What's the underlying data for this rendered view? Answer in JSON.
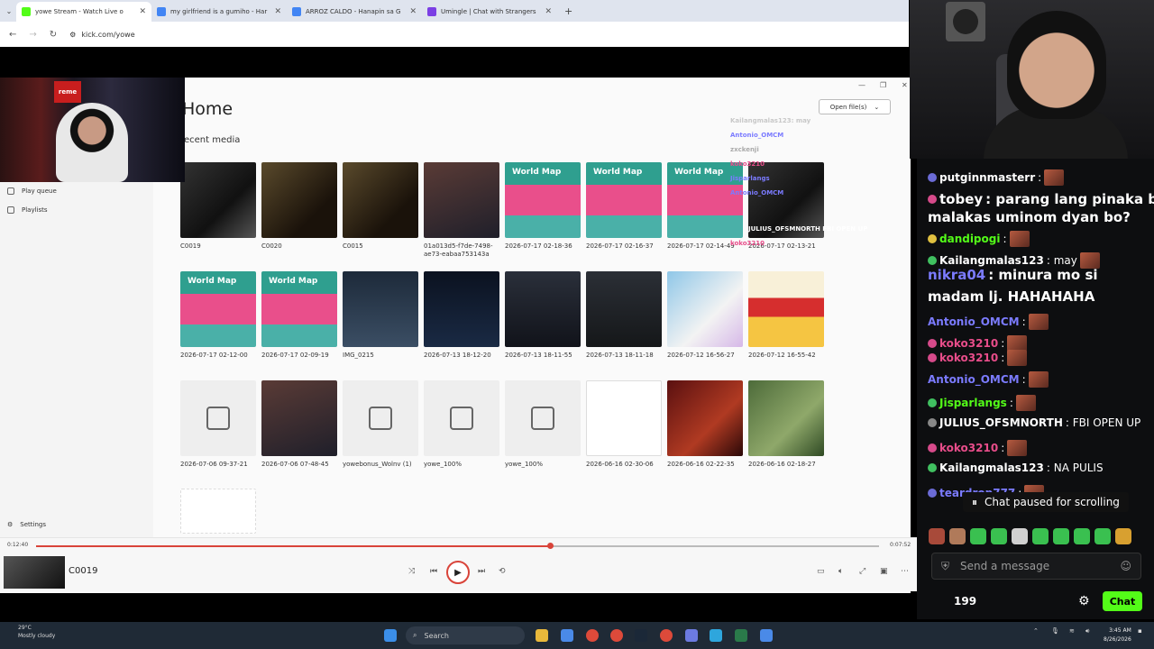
{
  "browser": {
    "tabs": [
      {
        "title": "yowe Stream - Watch Live o",
        "color": "#53fc18",
        "active": true
      },
      {
        "title": "my girlfriend is a gumiho - Har",
        "color": "#4285f4",
        "active": false
      },
      {
        "title": "ARROZ CALDO - Hanapin sa G",
        "color": "#4285f4",
        "active": false
      },
      {
        "title": "Umingle | Chat with Strangers",
        "color": "#7b3fe4",
        "active": false
      }
    ],
    "url": "kick.com/yowe"
  },
  "media_app": {
    "page_title": "Home",
    "section_title": "ecent media",
    "open_button": "Open file(s)",
    "sidebar": [
      {
        "label": "Play queue",
        "icon": "queue-icon"
      },
      {
        "label": "Playlists",
        "icon": "playlist-icon"
      }
    ],
    "settings_label": "Settings",
    "map_text": "World Map",
    "tiles": [
      {
        "caption": "C0019",
        "style": "t-dark"
      },
      {
        "caption": "C0020",
        "style": "t-bar"
      },
      {
        "caption": "C0015",
        "style": "t-bar"
      },
      {
        "caption": "01a013d5-f7de-7498-ae73-eabaa753143a",
        "style": "t-face"
      },
      {
        "caption": "2026-07-17 02-18-36",
        "style": "t-map"
      },
      {
        "caption": "2026-07-17 02-16-37",
        "style": "t-map"
      },
      {
        "caption": "2026-07-17 02-14-49",
        "style": "t-map"
      },
      {
        "caption": "2026-07-17 02-13-21",
        "style": "t-dark"
      },
      {
        "caption": "2026-07-17 02-12-00",
        "style": "t-map"
      },
      {
        "caption": "2026-07-17 02-09-19",
        "style": "t-map"
      },
      {
        "caption": "IMG_0215",
        "style": "t-doc"
      },
      {
        "caption": "2026-07-13 18-12-20",
        "style": "t-space"
      },
      {
        "caption": "2026-07-13 18-11-55",
        "style": "t-cave"
      },
      {
        "caption": "2026-07-13 18-11-18",
        "style": "t-ui"
      },
      {
        "caption": "2026-07-12 16-56-27",
        "style": "t-anime"
      },
      {
        "caption": "2026-07-12 16-55-42",
        "style": "t-web"
      },
      {
        "caption": "2026-07-06 09-37-21",
        "style": "ph"
      },
      {
        "caption": "2026-07-06 07-48-45",
        "style": "t-face"
      },
      {
        "caption": "yowebonus_Wolnv (1)",
        "style": "ph"
      },
      {
        "caption": "yowe_100%",
        "style": "ph"
      },
      {
        "caption": "yowe_100%",
        "style": "ph"
      },
      {
        "caption": "2026-06-16 02-30-06",
        "style": "t-paper"
      },
      {
        "caption": "2026-06-16 02-22-35",
        "style": "t-red"
      },
      {
        "caption": "2026-06-16 02-18-27",
        "style": "t-green"
      }
    ],
    "player": {
      "elapsed": "0:12:40",
      "total": "0:07:52",
      "progress": 0.61,
      "now_playing": "C0019"
    }
  },
  "overlay_chat": [
    "Kailangmalas123: may",
    "Antonio_OMCM",
    "zxckenji",
    "koko3210",
    "Jisparlangs",
    "Antonio_OMCM",
    "JULIUS_OFSMNORTH  FBI OPEN UP",
    "koko3210"
  ],
  "chat": {
    "messages": [
      {
        "user": "putginnmasterr",
        "text": ":",
        "color": "#ffffff",
        "badge": "#6b6bd6"
      },
      {
        "user": "tobey",
        "text": ": parang lang pinaka budha dyan",
        "color": "#ffffff",
        "badge": "#d64a8a"
      },
      {
        "user": "",
        "text": "malakas uminom dyan bo?",
        "color": "#ffffff",
        "badge": ""
      },
      {
        "user": "dandipogi",
        "text": ":",
        "color": "#53fc18",
        "badge": "#e0c040"
      },
      {
        "user": "Kailangmalas123",
        "text": ": may",
        "color": "#ffffff",
        "badge": "#40c060"
      },
      {
        "user": "nikra04",
        "text": ": minura mo si",
        "color": "#7b7bff",
        "badge": ""
      },
      {
        "user": "",
        "text": "madam lj. HAHAHAHA",
        "color": "#ffffff",
        "badge": ""
      },
      {
        "user": "Antonio_OMCM",
        "text": ":",
        "color": "#7b7bff",
        "badge": ""
      },
      {
        "user": "koko3210",
        "text": ":",
        "color": "#e84d8a",
        "badge": "#d64a8a"
      },
      {
        "user": "koko3210",
        "text": ":",
        "color": "#e84d8a",
        "badge": "#d64a8a"
      },
      {
        "user": "Antonio_OMCM",
        "text": ":",
        "color": "#7b7bff",
        "badge": ""
      },
      {
        "user": "Jisparlangs",
        "text": ":",
        "color": "#53fc18",
        "badge": "#40c060"
      },
      {
        "user": "JULIUS_OFSMNORTH",
        "text": ": FBI OPEN UP",
        "color": "#ffffff",
        "badge": "#888888"
      },
      {
        "user": "koko3210",
        "text": ":",
        "color": "#e84d8a",
        "badge": "#d64a8a"
      },
      {
        "user": "Kailangmalas123",
        "text": ": NA PULIS",
        "color": "#ffffff",
        "badge": "#40c060"
      },
      {
        "user": "teardrop777",
        "text": ":",
        "color": "#7b7bff",
        "badge": "#6b6bd6"
      }
    ],
    "paused_label": "Chat paused for scrolling",
    "send_placeholder": "Send a message",
    "viewers": "199",
    "chat_button": "Chat"
  },
  "taskbar": {
    "temperature": "29°C",
    "weather": "Mostly cloudy",
    "search": "Search",
    "time": "3:45 AM",
    "date": "8/26/2026"
  }
}
